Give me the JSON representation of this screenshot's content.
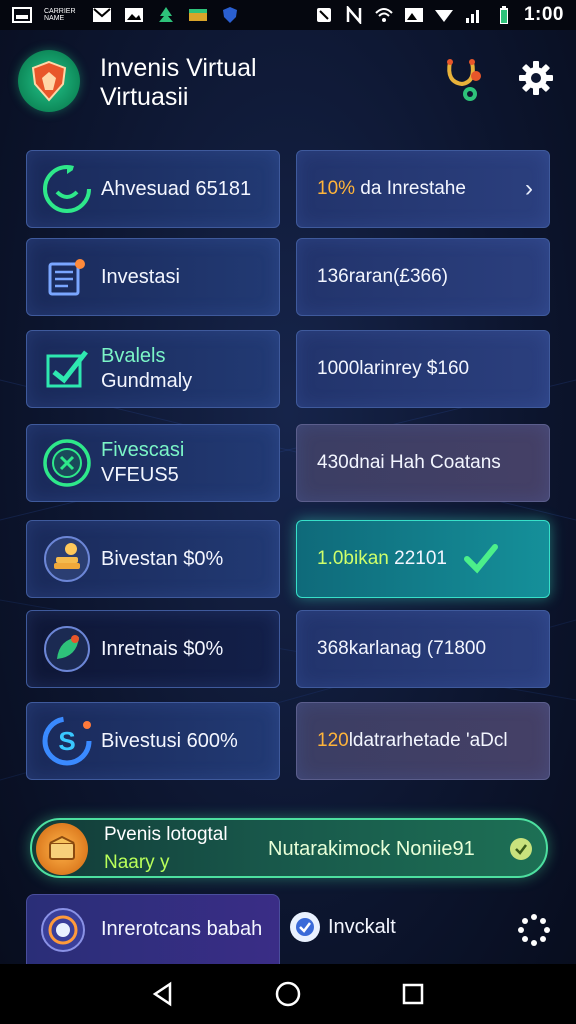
{
  "status_bar": {
    "carrier": "CARRIER NAME",
    "time": "1:00",
    "icons": [
      "notification-icon",
      "mail-icon",
      "image-icon",
      "tree-icon",
      "flag-icon",
      "shield-icon",
      "mute-icon",
      "nfc-icon",
      "wifi-icon",
      "photo-icon",
      "signal-icon",
      "battery-icon"
    ]
  },
  "header": {
    "title_line1": "Invenis Virtual",
    "title_line2": "Virtuasii",
    "icons": [
      "app-logo-icon",
      "stethoscope-icon",
      "settings-icon"
    ]
  },
  "cards": [
    {
      "left": {
        "icon": "refresh-cycle-icon",
        "line1": "Ahvesuad 65181",
        "line2": ""
      },
      "right": {
        "prefix": "10%",
        "text": " da Inrestahe",
        "has_chevron": true,
        "style": "normal"
      }
    },
    {
      "left": {
        "icon": "document-icon",
        "line1": "Investasi",
        "line2": ""
      },
      "right": {
        "prefix": "",
        "text": "136raran(£366)",
        "has_chevron": false,
        "style": "normal"
      }
    },
    {
      "left": {
        "icon": "checkmark-chart-icon",
        "line1": "Bvalels",
        "line2": "Gundmaly"
      },
      "right": {
        "prefix": "",
        "text": "1000larinrey $160",
        "has_chevron": false,
        "style": "normal"
      }
    },
    {
      "left": {
        "icon": "globe-leaf-icon",
        "line1": "Fivescasi",
        "line2": "VFEUS5"
      },
      "right": {
        "prefix": "",
        "text": "430dnai Hah Coatans",
        "has_chevron": false,
        "style": "alt"
      }
    },
    {
      "left": {
        "icon": "coin-stack-icon",
        "line1": "Bivestan $0%",
        "line2": ""
      },
      "right": {
        "prefix": "1.0bikan",
        "text": " 22101",
        "has_chevron": false,
        "style": "active"
      }
    },
    {
      "left": {
        "icon": "leaf-icon",
        "line1": "Inretnais $0%",
        "line2": ""
      },
      "right": {
        "prefix": "",
        "text": "368karlanag (71800",
        "has_chevron": false,
        "style": "normal"
      }
    },
    {
      "left": {
        "icon": "dollar-cycle-icon",
        "line1": "Bivestusi 600%",
        "line2": ""
      },
      "right": {
        "prefix": "120",
        "text": "ldatrarhetade 'aDcl",
        "has_chevron": false,
        "style": "alt"
      }
    }
  ],
  "banner": {
    "icon": "treasure-box-icon",
    "title": "Pvenis lotogtal",
    "subtitle": "Naary y",
    "right_text": "Nutarakimock Noniie91",
    "check_icon": "check-circle-icon"
  },
  "last_row": {
    "left_icon": "target-icon",
    "left_text": "Inrerotcans babah",
    "check_text": "Invckalt",
    "check_icon": "checkbox-checked-icon",
    "spinner_icon": "loading-spinner-icon"
  },
  "nav": {
    "icons": [
      "back-icon",
      "home-icon",
      "recents-icon"
    ]
  },
  "colors": {
    "accent_green": "#37e0c9",
    "highlight_orange": "#ffb43a",
    "card_border": "#3f5a9c",
    "banner_border": "#4de0a0"
  }
}
